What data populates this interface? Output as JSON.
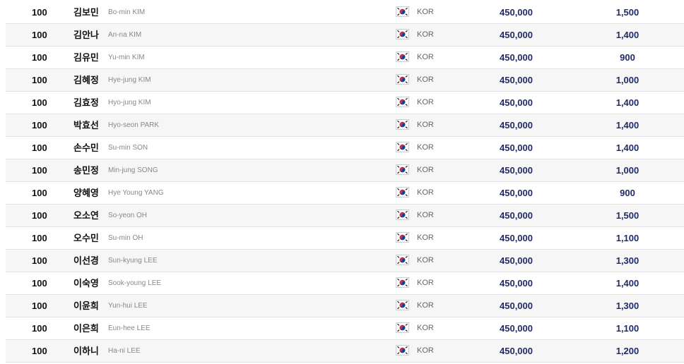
{
  "table": {
    "rows": [
      {
        "rank": "100",
        "name_kr": "김보민",
        "name_en": "Bo-min KIM",
        "flag_icon": "korea-flag-icon",
        "country": "KOR",
        "points": "450,000",
        "score": "1,500"
      },
      {
        "rank": "100",
        "name_kr": "김안나",
        "name_en": "An-na KIM",
        "flag_icon": "korea-flag-icon",
        "country": "KOR",
        "points": "450,000",
        "score": "1,400"
      },
      {
        "rank": "100",
        "name_kr": "김유민",
        "name_en": "Yu-min KIM",
        "flag_icon": "korea-flag-icon",
        "country": "KOR",
        "points": "450,000",
        "score": "900"
      },
      {
        "rank": "100",
        "name_kr": "김혜정",
        "name_en": "Hye-jung KIM",
        "flag_icon": "korea-flag-icon",
        "country": "KOR",
        "points": "450,000",
        "score": "1,000"
      },
      {
        "rank": "100",
        "name_kr": "김효정",
        "name_en": "Hyo-jung KIM",
        "flag_icon": "korea-flag-icon",
        "country": "KOR",
        "points": "450,000",
        "score": "1,400"
      },
      {
        "rank": "100",
        "name_kr": "박효선",
        "name_en": "Hyo-seon PARK",
        "flag_icon": "korea-flag-icon",
        "country": "KOR",
        "points": "450,000",
        "score": "1,400"
      },
      {
        "rank": "100",
        "name_kr": "손수민",
        "name_en": "Su-min SON",
        "flag_icon": "korea-flag-icon",
        "country": "KOR",
        "points": "450,000",
        "score": "1,400"
      },
      {
        "rank": "100",
        "name_kr": "송민정",
        "name_en": "Min-jung SONG",
        "flag_icon": "korea-flag-icon",
        "country": "KOR",
        "points": "450,000",
        "score": "1,000"
      },
      {
        "rank": "100",
        "name_kr": "양혜영",
        "name_en": "Hye Young YANG",
        "flag_icon": "korea-flag-icon",
        "country": "KOR",
        "points": "450,000",
        "score": "900"
      },
      {
        "rank": "100",
        "name_kr": "오소연",
        "name_en": "So-yeon OH",
        "flag_icon": "korea-flag-icon",
        "country": "KOR",
        "points": "450,000",
        "score": "1,500"
      },
      {
        "rank": "100",
        "name_kr": "오수민",
        "name_en": "Su-min OH",
        "flag_icon": "korea-flag-icon",
        "country": "KOR",
        "points": "450,000",
        "score": "1,100"
      },
      {
        "rank": "100",
        "name_kr": "이선경",
        "name_en": "Sun-kyung LEE",
        "flag_icon": "korea-flag-icon",
        "country": "KOR",
        "points": "450,000",
        "score": "1,300"
      },
      {
        "rank": "100",
        "name_kr": "이숙영",
        "name_en": "Sook-young LEE",
        "flag_icon": "korea-flag-icon",
        "country": "KOR",
        "points": "450,000",
        "score": "1,400"
      },
      {
        "rank": "100",
        "name_kr": "이윤희",
        "name_en": "Yun-hui LEE",
        "flag_icon": "korea-flag-icon",
        "country": "KOR",
        "points": "450,000",
        "score": "1,300"
      },
      {
        "rank": "100",
        "name_kr": "이은희",
        "name_en": "Eun-hee LEE",
        "flag_icon": "korea-flag-icon",
        "country": "KOR",
        "points": "450,000",
        "score": "1,100"
      },
      {
        "rank": "100",
        "name_kr": "이하니",
        "name_en": "Ha-ni LEE",
        "flag_icon": "korea-flag-icon",
        "country": "KOR",
        "points": "450,000",
        "score": "1,200"
      }
    ]
  },
  "colors": {
    "numeric_text": "#1d2b6b",
    "row_alt_bg": "#f6f6f6",
    "row_border": "#e3e3e3"
  }
}
